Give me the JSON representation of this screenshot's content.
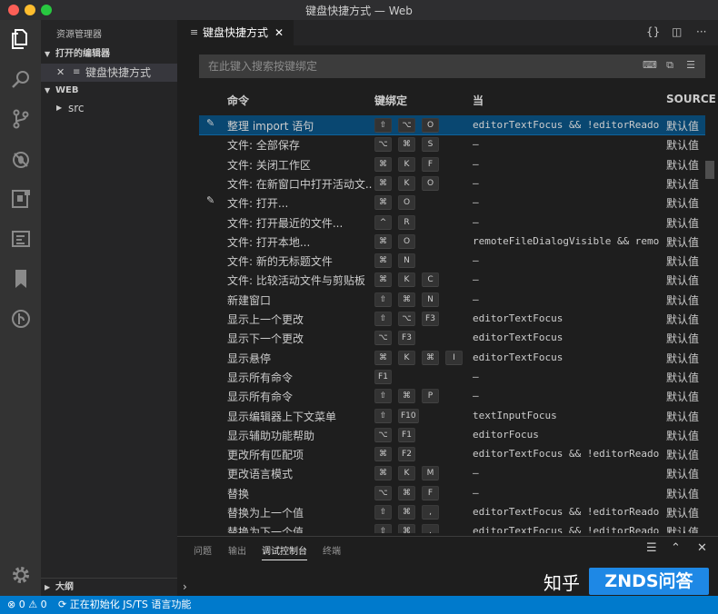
{
  "window": {
    "title": "键盘快捷方式 — Web"
  },
  "activity_bar": {
    "icons": [
      "explorer-icon",
      "search-icon",
      "source-control-icon",
      "debug-icon",
      "extensions-icon",
      "output-icon",
      "bookmark-icon",
      "git-graph-icon",
      "settings-gear-icon"
    ]
  },
  "sidebar": {
    "title": "资源管理器",
    "open_editors_label": "打开的编辑器",
    "open_editor_item": "键盘快捷方式",
    "folder_label": "WEB",
    "folder_item": "src",
    "outline_label": "大纲"
  },
  "tab": {
    "label": "键盘快捷方式"
  },
  "search": {
    "placeholder": "在此键入搜索按键绑定"
  },
  "columns": {
    "command": "命令",
    "keybinding": "键绑定",
    "when": "当",
    "source": "SOURCE"
  },
  "rows": [
    {
      "command": "整理 import 语句",
      "keys": [
        "⇧",
        "⌥",
        "O"
      ],
      "when": "editorTextFocus && !editorReadonly",
      "source": "默认值",
      "selected": true,
      "edit": true
    },
    {
      "command": "文件: 全部保存",
      "keys": [
        "⌥",
        "⌘",
        "S"
      ],
      "when": "—",
      "source": "默认值"
    },
    {
      "command": "文件: 关闭工作区",
      "keys": [
        "⌘",
        "K",
        "F"
      ],
      "when": "—",
      "source": "默认值"
    },
    {
      "command": "文件: 在新窗口中打开活动文...",
      "keys": [
        "⌘",
        "K",
        "O"
      ],
      "when": "—",
      "source": "默认值"
    },
    {
      "command": "文件: 打开...",
      "keys": [
        "⌘",
        "O"
      ],
      "when": "—",
      "source": "默认值",
      "edit": true
    },
    {
      "command": "文件: 打开最近的文件...",
      "keys": [
        "^",
        "R"
      ],
      "when": "—",
      "source": "默认值"
    },
    {
      "command": "文件: 打开本地...",
      "keys": [
        "⌘",
        "O"
      ],
      "when": "remoteFileDialogVisible && remoteFileDialogVisible",
      "source": "默认值"
    },
    {
      "command": "文件: 新的无标题文件",
      "keys": [
        "⌘",
        "N"
      ],
      "when": "—",
      "source": "默认值"
    },
    {
      "command": "文件: 比较活动文件与剪贴板",
      "keys": [
        "⌘",
        "K",
        "C"
      ],
      "when": "—",
      "source": "默认值"
    },
    {
      "command": "新建窗口",
      "keys": [
        "⇧",
        "⌘",
        "N"
      ],
      "when": "—",
      "source": "默认值"
    },
    {
      "command": "显示上一个更改",
      "keys": [
        "⇧",
        "⌥",
        "F3"
      ],
      "when": "editorTextFocus",
      "source": "默认值"
    },
    {
      "command": "显示下一个更改",
      "keys": [
        "⌥",
        "F3"
      ],
      "when": "editorTextFocus",
      "source": "默认值"
    },
    {
      "command": "显示悬停",
      "keys": [
        "⌘",
        "K",
        "⌘",
        "I"
      ],
      "when": "editorTextFocus",
      "source": "默认值"
    },
    {
      "command": "显示所有命令",
      "keys": [
        "F1"
      ],
      "when": "—",
      "source": "默认值"
    },
    {
      "command": "显示所有命令",
      "keys": [
        "⇧",
        "⌘",
        "P"
      ],
      "when": "—",
      "source": "默认值"
    },
    {
      "command": "显示编辑器上下文菜单",
      "keys": [
        "⇧",
        "F10"
      ],
      "when": "textInputFocus",
      "source": "默认值"
    },
    {
      "command": "显示辅助功能帮助",
      "keys": [
        "⌥",
        "F1"
      ],
      "when": "editorFocus",
      "source": "默认值"
    },
    {
      "command": "更改所有匹配项",
      "keys": [
        "⌘",
        "F2"
      ],
      "when": "editorTextFocus && !editorReadonly",
      "source": "默认值"
    },
    {
      "command": "更改语言模式",
      "keys": [
        "⌘",
        "K",
        "M"
      ],
      "when": "—",
      "source": "默认值"
    },
    {
      "command": "替换",
      "keys": [
        "⌥",
        "⌘",
        "F"
      ],
      "when": "—",
      "source": "默认值"
    },
    {
      "command": "替换为上一个值",
      "keys": [
        "⇧",
        "⌘",
        ","
      ],
      "when": "editorTextFocus && !editorReadonly",
      "source": "默认值"
    },
    {
      "command": "替换为下一个值",
      "keys": [
        "⇧",
        "⌘",
        "."
      ],
      "when": "editorTextFocus && !editorReadonly",
      "source": "默认值"
    }
  ],
  "panel": {
    "tabs": [
      "问题",
      "输出",
      "调试控制台",
      "终端"
    ],
    "active_tab": "调试控制台",
    "prompt": "›"
  },
  "status": {
    "errors": "0",
    "warnings": "0",
    "message": "正在初始化 JS/TS 语言功能"
  },
  "watermark": {
    "text": "知乎",
    "badge": "ZNDS问答"
  }
}
